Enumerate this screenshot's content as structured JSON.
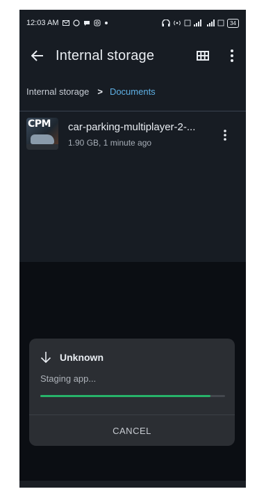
{
  "statusbar": {
    "time": "12:03 AM",
    "left_icons": [
      "mail-icon",
      "whatsapp-icon",
      "chat-icon",
      "instagram-icon",
      "dot-icon"
    ],
    "right_icons": [
      "headphones-icon",
      "hotspot-icon",
      "volte-icon",
      "signal-icon",
      "4g-signal-icon",
      "speed-icon"
    ],
    "battery": "34"
  },
  "appbar": {
    "title": "Internal storage",
    "back_icon": "arrow-left-icon",
    "grid_icon": "grid-view-icon",
    "more_icon": "more-vert-icon"
  },
  "breadcrumb": {
    "root": "Internal storage",
    "separator": ">",
    "current": "Documents"
  },
  "files": [
    {
      "name": "car-parking-multiplayer-2-...",
      "meta": "1.90 GB, 1 minute ago",
      "thumb_text": "CPM"
    }
  ],
  "dialog": {
    "title": "Unknown",
    "status": "Staging app...",
    "progress": 0.92,
    "cancel_label": "CANCEL"
  },
  "colors": {
    "background": "#0b0e13",
    "panel": "#171c23",
    "accent": "#5fb1e6",
    "progress": "#27b36a",
    "dialog": "#2b2e33"
  }
}
